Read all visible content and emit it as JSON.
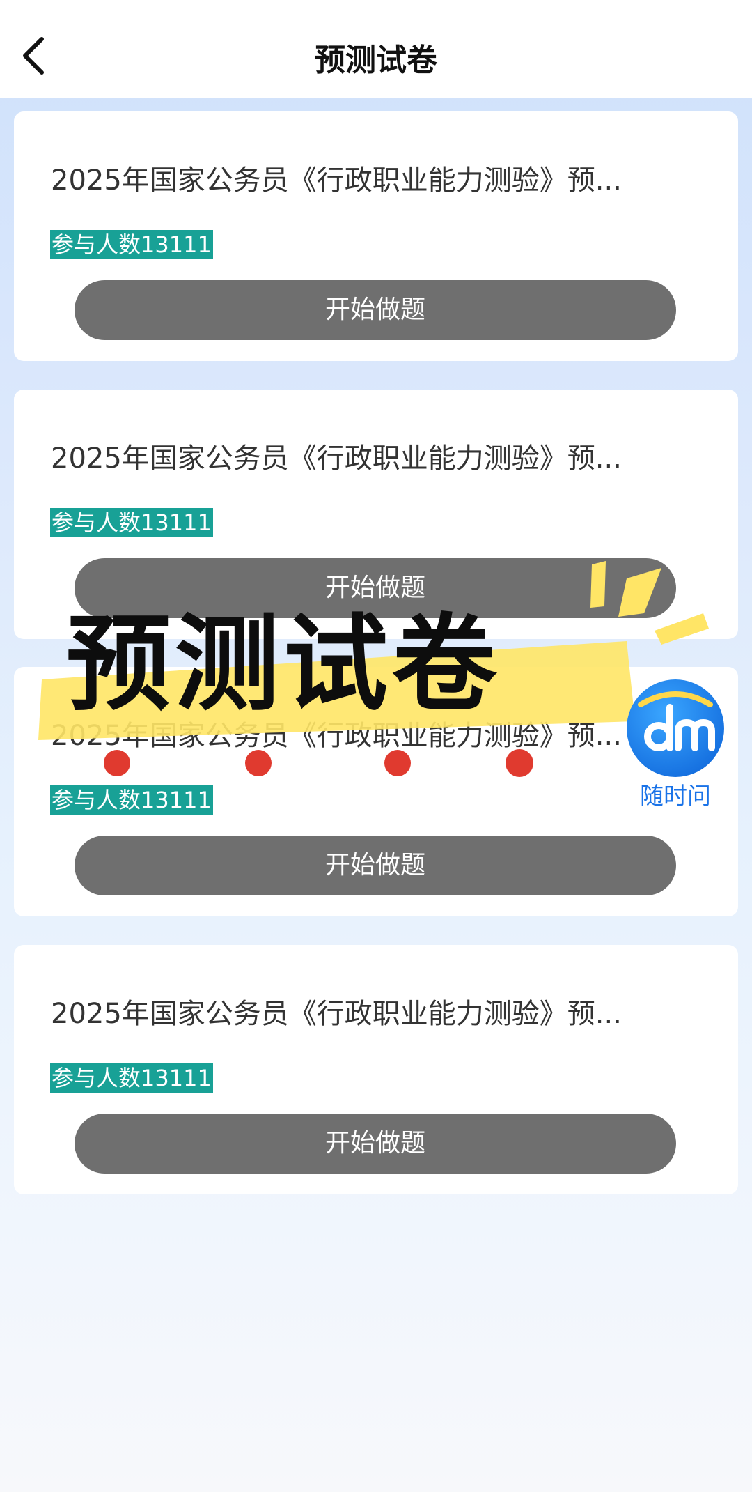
{
  "header": {
    "title": "预测试卷",
    "back_icon": "chevron-left-icon"
  },
  "cards": [
    {
      "title": "2025年国家公务员《行政职业能力测验》预...",
      "participants": "参与人数13111",
      "action": "开始做题"
    },
    {
      "title": "2025年国家公务员《行政职业能力测验》预...",
      "participants": "参与人数13111",
      "action": "开始做题"
    },
    {
      "title": "2025年国家公务员《行政职业能力测验》预...",
      "participants": "参与人数13111",
      "action": "开始做题"
    },
    {
      "title": "2025年国家公务员《行政职业能力测验》预...",
      "participants": "参与人数13111",
      "action": "开始做题"
    }
  ],
  "overlay": {
    "headline": "预测试卷",
    "logo_text": "dm",
    "logo_label": "随时问",
    "colors": {
      "highlight": "#ffe566",
      "dot": "#e03a2f",
      "logo": "#1a73e8",
      "badge": "#18a196",
      "button": "#6f6f6f"
    }
  }
}
